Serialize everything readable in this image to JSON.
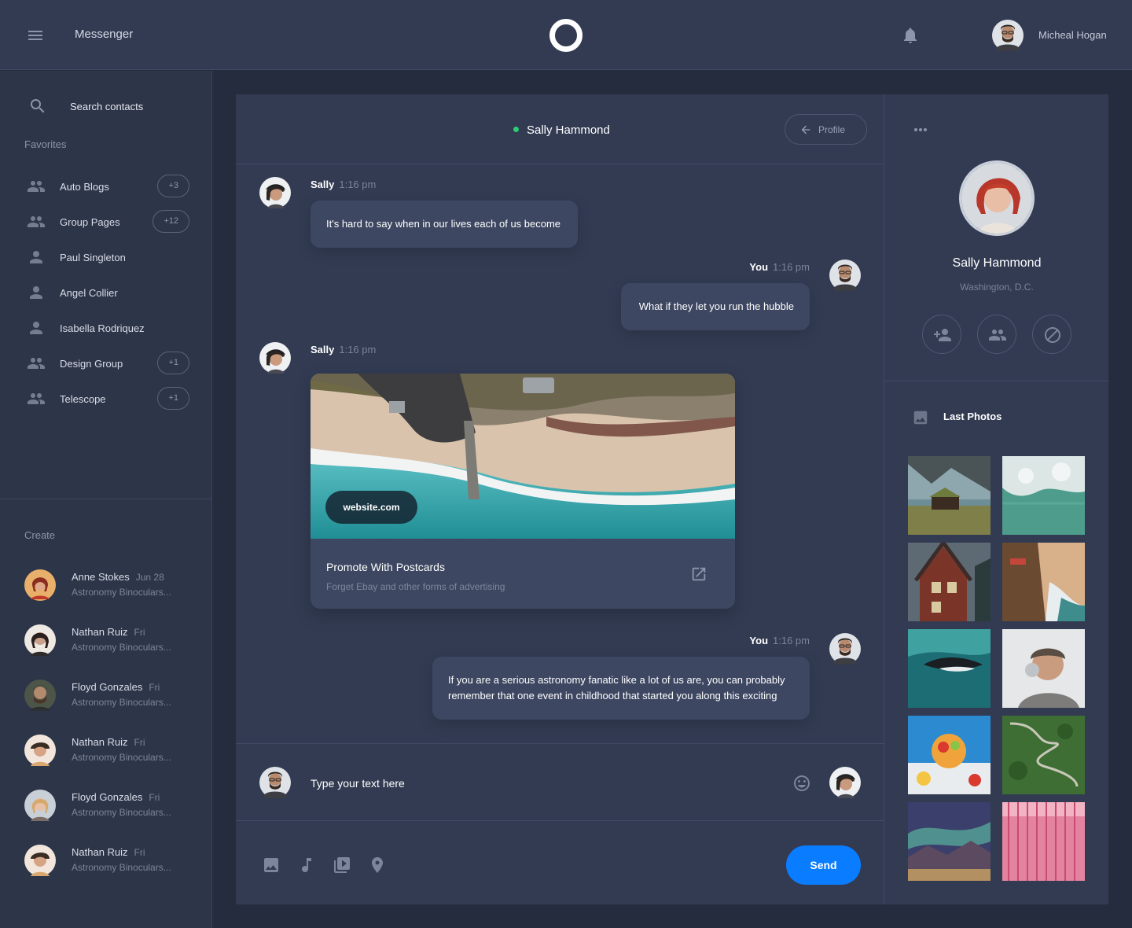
{
  "topbar": {
    "app_title": "Messenger",
    "user_name": "Micheal Hogan"
  },
  "sidebar": {
    "search_placeholder": "Search contacts",
    "favorites_label": "Favorites",
    "favorites": [
      {
        "name": "Auto Blogs",
        "badge": "+3",
        "icon": "group-icon"
      },
      {
        "name": "Group Pages",
        "badge": "+12",
        "icon": "group-icon"
      },
      {
        "name": "Paul Singleton",
        "badge": "",
        "icon": "person-icon"
      },
      {
        "name": "Angel Collier",
        "badge": "",
        "icon": "person-icon"
      },
      {
        "name": "Isabella Rodriquez",
        "badge": "",
        "icon": "person-icon"
      },
      {
        "name": "Design Group",
        "badge": "+1",
        "icon": "group-icon"
      },
      {
        "name": "Telescope",
        "badge": "+1",
        "icon": "group-icon"
      }
    ],
    "create_label": "Create",
    "recent": [
      {
        "name": "Anne Stokes",
        "date": "Jun 28",
        "preview": "Astronomy Binoculars..."
      },
      {
        "name": "Nathan Ruiz",
        "date": "Fri",
        "preview": "Astronomy Binoculars..."
      },
      {
        "name": "Floyd Gonzales",
        "date": "Fri",
        "preview": "Astronomy Binoculars..."
      },
      {
        "name": "Nathan Ruiz",
        "date": "Fri",
        "preview": "Astronomy Binoculars..."
      },
      {
        "name": "Floyd Gonzales",
        "date": "Fri",
        "preview": "Astronomy Binoculars..."
      },
      {
        "name": "Nathan Ruiz",
        "date": "Fri",
        "preview": "Astronomy Binoculars..."
      }
    ]
  },
  "chat": {
    "contact_name": "Sally Hammond",
    "status_color": "#2ecc71",
    "profile_button": "Profile",
    "messages": [
      {
        "sender": "Sally",
        "time": "1:16 pm",
        "text": "It's hard to say when in our lives each of us become"
      },
      {
        "sender": "You",
        "time": "1:16 pm",
        "text": "What if they let you run the hubble"
      },
      {
        "sender": "Sally",
        "time": "1:16 pm",
        "text": ""
      },
      {
        "sender": "You",
        "time": "1:16 pm",
        "text": "If you are a serious astronomy fanatic like a lot of us are, you can probably remember that one event in childhood that started you along this exciting"
      }
    ],
    "link_card": {
      "url": "website.com",
      "title": "Promote With Postcards",
      "description": "Forget Ebay and other forms of advertising"
    },
    "input_placeholder": "Type your text here",
    "send_label": "Send",
    "accent_color": "#0a7cff"
  },
  "details": {
    "name": "Sally Hammond",
    "location": "Washington, D.C.",
    "photos_title": "Last Photos"
  }
}
